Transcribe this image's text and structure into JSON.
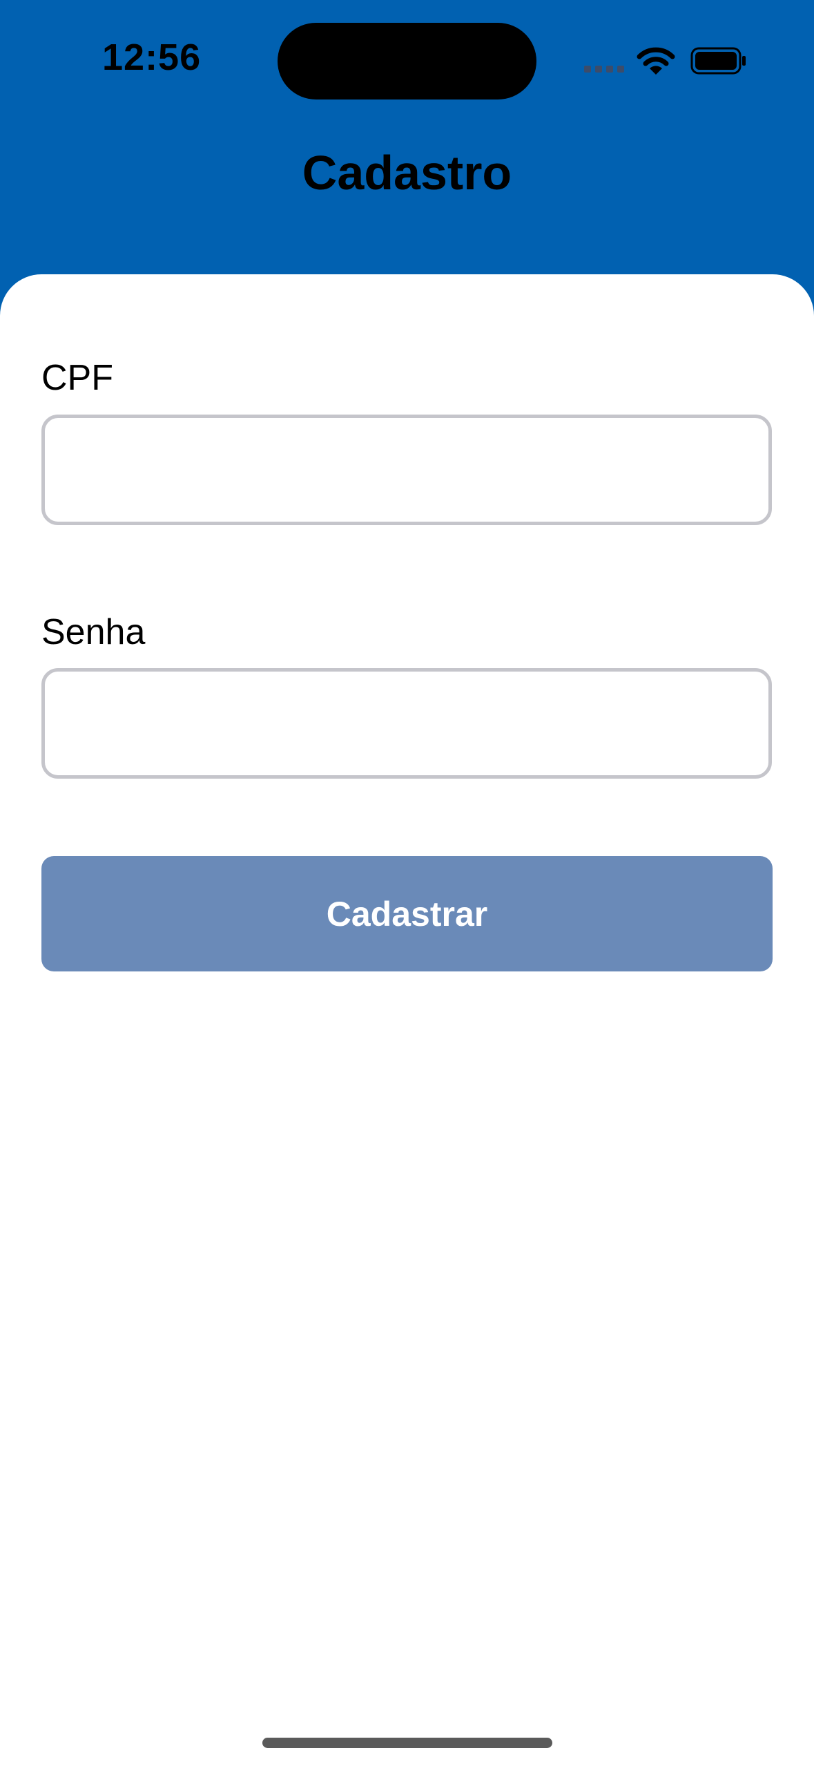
{
  "status_bar": {
    "time": "12:56"
  },
  "header": {
    "title": "Cadastro"
  },
  "form": {
    "cpf": {
      "label": "CPF",
      "value": "",
      "placeholder": ""
    },
    "senha": {
      "label": "Senha",
      "value": "",
      "placeholder": ""
    },
    "submit_label": "Cadastrar"
  },
  "colors": {
    "header_background": "#0161B1",
    "card_background": "#FFFFFF",
    "input_border": "#C5C5CB",
    "button_background": "#6A8AB8",
    "button_text": "#FFFFFF"
  },
  "icons": [
    "cellular-signal-icon",
    "wifi-icon",
    "battery-icon"
  ]
}
